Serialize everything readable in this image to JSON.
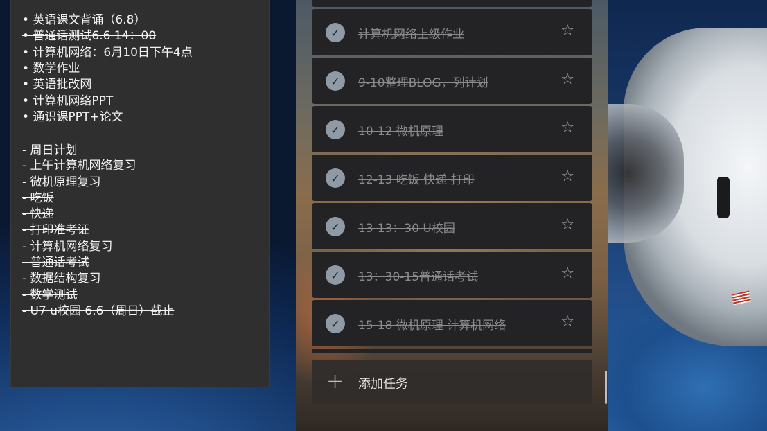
{
  "notes": {
    "lines": [
      {
        "text": "• 英语课文背诵（6.8）",
        "done": false
      },
      {
        "text": "• 普通话测试6.6 14：00",
        "done": true
      },
      {
        "text": "• 计算机网络：6月10日下午4点",
        "done": false
      },
      {
        "text": "• 数学作业",
        "done": false
      },
      {
        "text": "• 英语批改网",
        "done": false
      },
      {
        "text": "• 计算机网络PPT",
        "done": false
      },
      {
        "text": "• 通识课PPT+论文",
        "done": false
      },
      {
        "text": "- 周日计划",
        "done": false
      },
      {
        "text": "- 上午计算机网络复习",
        "done": false
      },
      {
        "text": "- 微机原理复习",
        "done": true
      },
      {
        "text": "- 吃饭",
        "done": true
      },
      {
        "text": "- 快递",
        "done": true
      },
      {
        "text": "- 打印准考证",
        "done": true
      },
      {
        "text": "- 计算机网络复习",
        "done": false
      },
      {
        "text": "- 普通话考试",
        "done": true
      },
      {
        "text": "- 数据结构复习",
        "done": false
      },
      {
        "text": "- 数学测试",
        "done": true
      },
      {
        "text": "- U7 u校园 6.6（周日）截止",
        "done": true
      }
    ]
  },
  "tasks": {
    "items": [
      {
        "title": "计算机网络上级作业",
        "completed": true,
        "starred": false
      },
      {
        "title": "9-10整理BLOG，列计划",
        "completed": true,
        "starred": false
      },
      {
        "title": "10-12 微机原理",
        "completed": true,
        "starred": false
      },
      {
        "title": "12-13 吃饭 快递 打印",
        "completed": true,
        "starred": false
      },
      {
        "title": "13-13：30 U校园",
        "completed": true,
        "starred": false
      },
      {
        "title": "13：30-15普通话考试",
        "completed": true,
        "starred": false
      },
      {
        "title": "15-18 微机原理 计算机网络",
        "completed": true,
        "starred": false
      }
    ],
    "add_label": "添加任务",
    "add_icon": "plus-icon",
    "check_icon": "checkmark-icon",
    "star_icon": "star-outline-icon"
  },
  "colors": {
    "panel": "#2f2f30",
    "task_bg": "#232325",
    "check": "#8e9aa6",
    "muted_text": "#8a8a8a"
  }
}
